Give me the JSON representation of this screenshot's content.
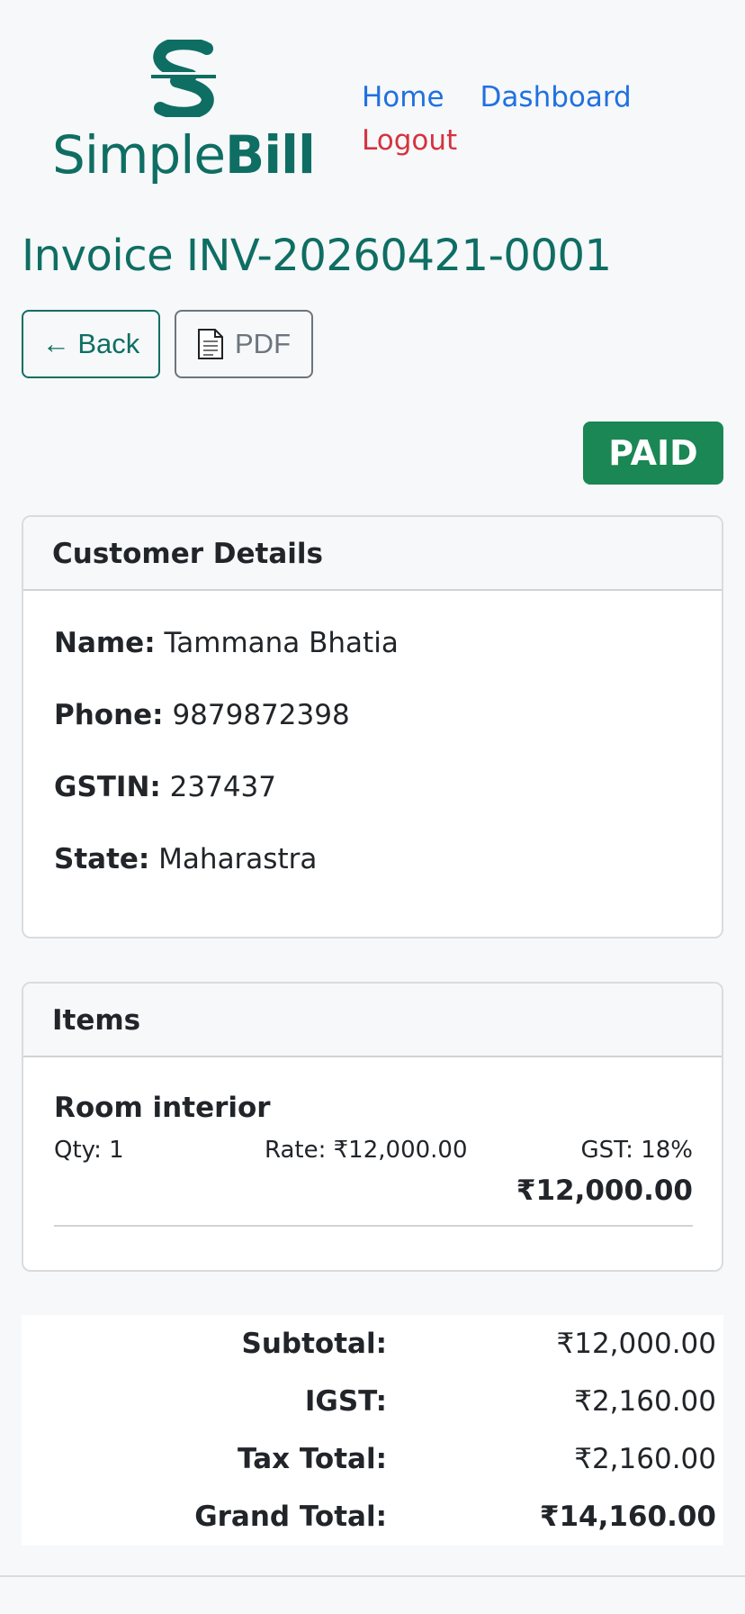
{
  "header": {
    "logo": {
      "simple": "Simple",
      "bill": "Bill",
      "brand_color": "#0f6e63"
    },
    "nav": {
      "home": "Home",
      "dashboard": "Dashboard",
      "logout": "Logout"
    }
  },
  "page": {
    "title": "Invoice INV-20260421-0001",
    "back_label": "← Back",
    "pdf_label": "PDF",
    "status": "PAID",
    "status_color": "#1a8754"
  },
  "customer": {
    "header": "Customer Details",
    "name_label": "Name:",
    "name": "Tammana Bhatia",
    "phone_label": "Phone:",
    "phone": "9879872398",
    "gstin_label": "GSTIN:",
    "gstin": "237437",
    "state_label": "State:",
    "state": "Maharastra"
  },
  "items": {
    "header": "Items",
    "list": [
      {
        "name": "Room interior",
        "qty": "Qty: 1",
        "rate": "Rate: ₹12,000.00",
        "gst": "GST: 18%",
        "amount": "₹12,000.00"
      }
    ]
  },
  "totals": {
    "subtotal_label": "Subtotal:",
    "subtotal": "₹12,000.00",
    "igst_label": "IGST:",
    "igst": "₹2,160.00",
    "tax_label": "Tax Total:",
    "tax": "₹2,160.00",
    "grand_label": "Grand Total:",
    "grand": "₹14,160.00"
  }
}
